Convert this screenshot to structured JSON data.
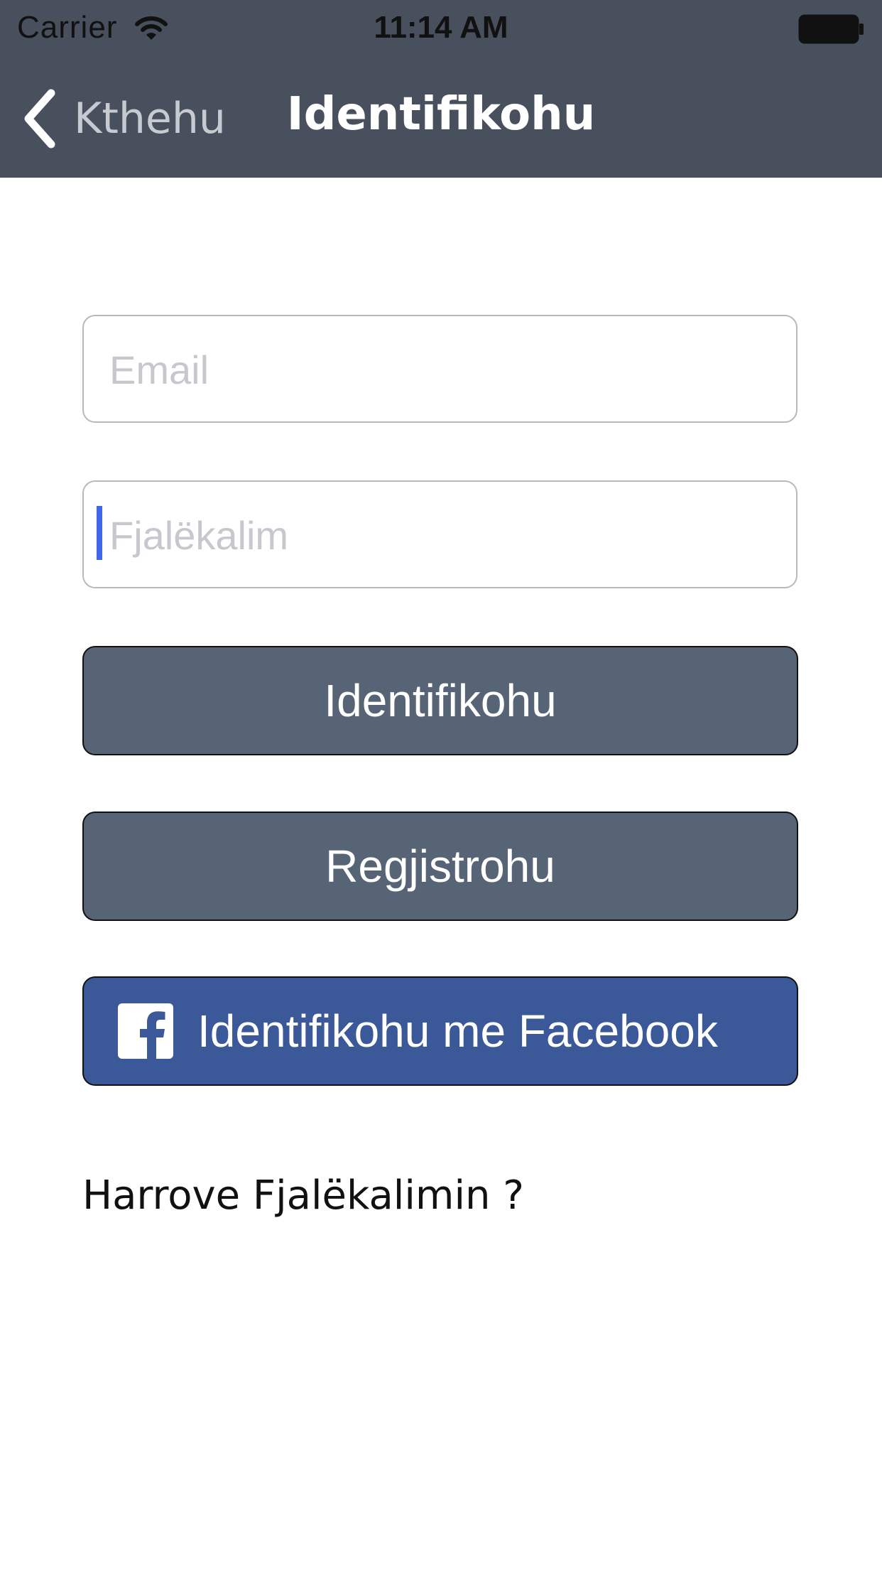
{
  "status_bar": {
    "carrier": "Carrier",
    "time": "11:14 AM",
    "wifi_icon": "wifi-icon",
    "battery_icon": "battery-icon"
  },
  "nav": {
    "back_label": "Kthehu",
    "back_icon": "chevron-left-icon",
    "title": "Identifikohu"
  },
  "form": {
    "email": {
      "placeholder": "Email",
      "value": ""
    },
    "password": {
      "placeholder": "Fjalëkalim",
      "value": ""
    },
    "login_label": "Identifikohu",
    "register_label": "Regjistrohu",
    "facebook_label": "Identifikohu me Facebook",
    "facebook_icon": "facebook-icon",
    "forgot_label": "Harrove Fjalëkalimin ?"
  },
  "colors": {
    "topbar": "#47505c",
    "button_slate": "#566476",
    "facebook_blue": "#3b5998",
    "caret": "#3f66e6"
  }
}
